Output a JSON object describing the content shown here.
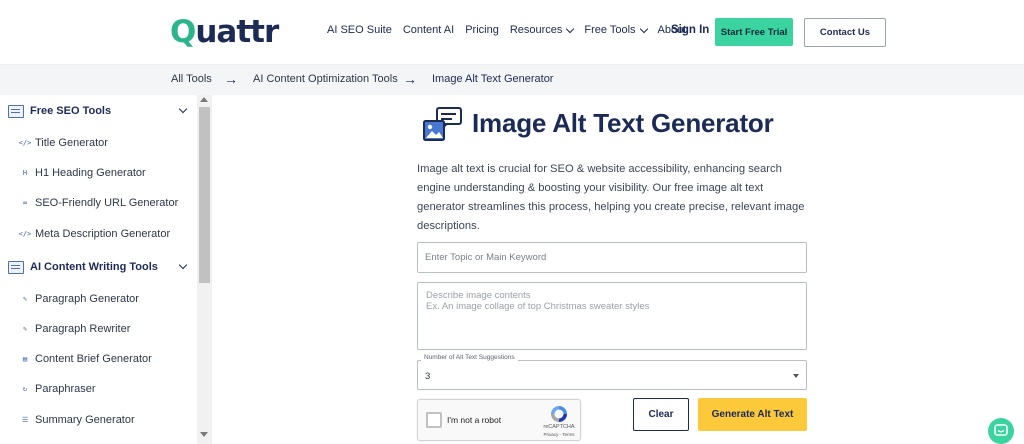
{
  "header": {
    "logo_text": "Quattr",
    "nav": [
      {
        "label": "AI SEO Suite",
        "dropdown": false
      },
      {
        "label": "Content AI",
        "dropdown": false
      },
      {
        "label": "Pricing",
        "dropdown": false
      },
      {
        "label": "Resources",
        "dropdown": true
      },
      {
        "label": "Free Tools",
        "dropdown": true
      },
      {
        "label": "About",
        "dropdown": false
      }
    ],
    "signin_label": "Sign In",
    "trial_label": "Start Free Trial",
    "contact_label": "Contact Us"
  },
  "breadcrumb": {
    "items": [
      "All Tools",
      "AI Content Optimization Tools",
      "Image Alt Text Generator"
    ]
  },
  "sidebar": {
    "sections": [
      {
        "title": "Free SEO Tools",
        "items": [
          "Title Generator",
          "H1 Heading Generator",
          "SEO-Friendly URL Generator",
          "Meta Description Generator"
        ]
      },
      {
        "title": "AI Content Writing Tools",
        "items": [
          "Paragraph Generator",
          "Paragraph Rewriter",
          "Content Brief Generator",
          "Paraphraser",
          "Summary Generator"
        ]
      }
    ]
  },
  "main": {
    "title": "Image Alt Text Generator",
    "description": "Image alt text is crucial for SEO & website accessibility, enhancing search engine understanding & boosting your visibility. Our free image alt text generator streamlines this process, helping you create precise, relevant image descriptions.",
    "topic_placeholder": "Enter Topic or Main Keyword",
    "description_placeholder": "Describe image contents\nEx. An image collage of top Christmas sweater styles",
    "suggestions_label": "Number of Alt Text Suggestions",
    "suggestions_value": "3",
    "recaptcha_label": "I'm not a robot",
    "recaptcha_brand": "reCAPTCHA",
    "recaptcha_terms": "Privacy - Terms",
    "clear_label": "Clear",
    "generate_label": "Generate Alt Text"
  },
  "colors": {
    "brand_navy": "#1c2a56",
    "brand_green": "#3bd4a0",
    "generate_yellow": "#fbc93a"
  }
}
